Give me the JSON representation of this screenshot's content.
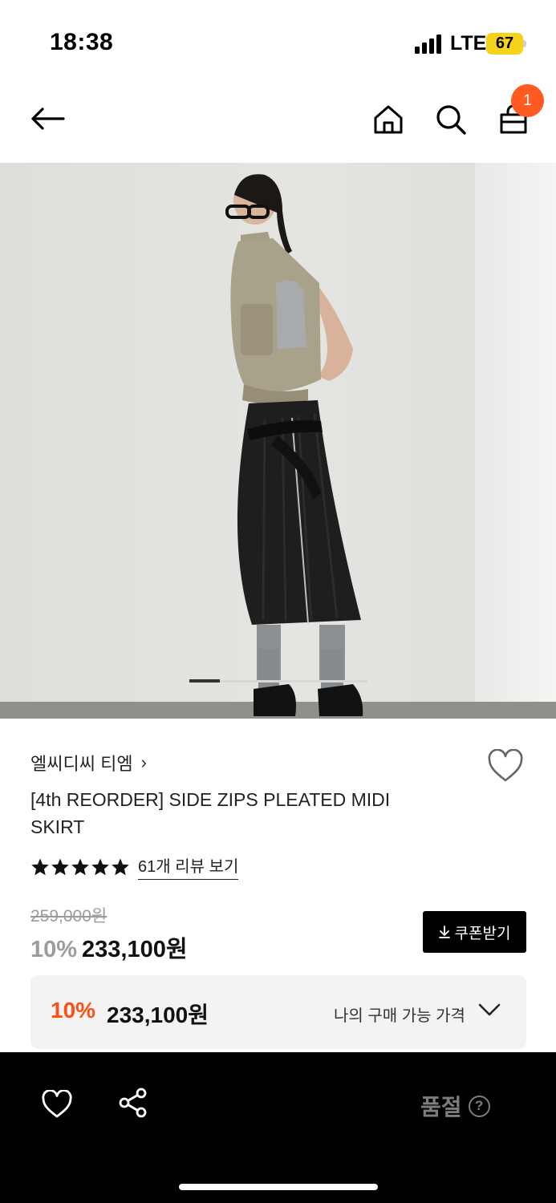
{
  "status_bar": {
    "time": "18:38",
    "network": "LTE",
    "battery": "67"
  },
  "nav": {
    "cart_count": "1"
  },
  "gallery": {
    "progress": 0.17
  },
  "product": {
    "brand": "엘씨디씨 티엠",
    "brand_chevron": "›",
    "title": "[4th REORDER] SIDE ZIPS PLEATED MIDI SKIRT",
    "rating_stars": 5,
    "review_link": "61개 리뷰 보기",
    "original_price": "259,000원",
    "discount_pct": "10%",
    "sale_price": "233,100원",
    "coupon_label": "쿠폰받기"
  },
  "my_price": {
    "discount_pct": "10%",
    "price": "233,100원",
    "label": "나의 구매 가능 가격"
  },
  "bottom_bar": {
    "soldout_label": "품절",
    "help_glyph": "?"
  },
  "colors": {
    "accent": "#ff4e16",
    "badge": "#ff5a1f",
    "battery": "#f7d21b",
    "bar_bg": "#000000"
  },
  "icons": [
    "back-arrow-icon",
    "home-icon",
    "search-icon",
    "cart-icon",
    "heart-icon",
    "star-icon",
    "download-icon",
    "chevron-down-icon",
    "share-icon",
    "help-icon"
  ]
}
